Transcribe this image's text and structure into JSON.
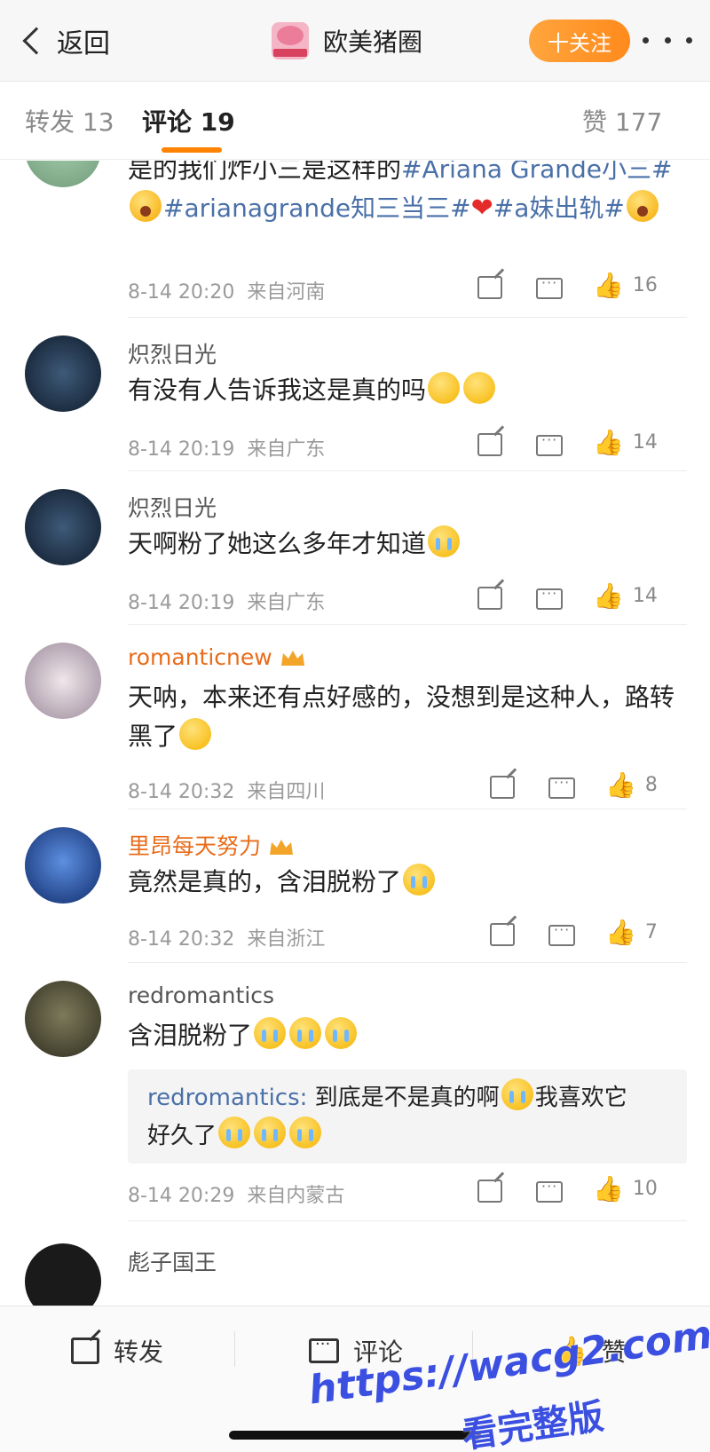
{
  "nav": {
    "back_label": "返回",
    "title": "欧美猪圈",
    "follow_label": "十关注"
  },
  "tabs": [
    {
      "label": "转发 13"
    },
    {
      "label": "评论 19"
    },
    {
      "label": "赞 177"
    }
  ],
  "comments": [
    {
      "segments": [
        "是的我们炸小三是这样的",
        "#Ariana Grande小三#",
        "#arianagrande知三当三#",
        "#a妹出轨#"
      ],
      "time": "8-14 20:20",
      "location": "来自河南",
      "likes": "16"
    },
    {
      "username": "炽烈日光",
      "text": "有没有人告诉我这是真的吗",
      "time": "8-14 20:19",
      "location": "来自广东",
      "likes": "14"
    },
    {
      "username": "炽烈日光",
      "text": "天啊粉了她这么多年才知道",
      "time": "8-14 20:19",
      "location": "来自广东",
      "likes": "14"
    },
    {
      "username": "romanticnew",
      "text": "天呐，本来还有点好感的，没想到是这种人，路转黑了",
      "time": "8-14 20:32",
      "location": "来自四川",
      "likes": "8"
    },
    {
      "username": "里昂每天努力",
      "text": "竟然是真的，含泪脱粉了",
      "time": "8-14 20:32",
      "location": "来自浙江",
      "likes": "7"
    },
    {
      "username": "redromantics",
      "text": "含泪脱粉了",
      "quote_name": "redromantics:",
      "quote_text": "到底是不是真的啊",
      "quote_text2": "我喜欢它",
      "quote_text3": "好久了",
      "time": "8-14 20:29",
      "location": "来自内蒙古",
      "likes": "10"
    }
  ],
  "partial_username": "彪子国王",
  "bottom": {
    "share_label": "转发",
    "comment_label": "评论",
    "like_label": "赞"
  },
  "watermark": {
    "line1": "https://wacg2.com",
    "line2": "看完整版"
  },
  "colors": {
    "accent": "#ff8200",
    "topic_link": "#4a70a8",
    "vip_name": "#e86c1a",
    "watermark": "#3b4fe0"
  },
  "icons": [
    "back-chevron-icon",
    "more-dots-icon",
    "share-icon",
    "comment-icon",
    "like-icon",
    "crown-badge-icon",
    "emoji-icon",
    "heart-icon"
  ]
}
